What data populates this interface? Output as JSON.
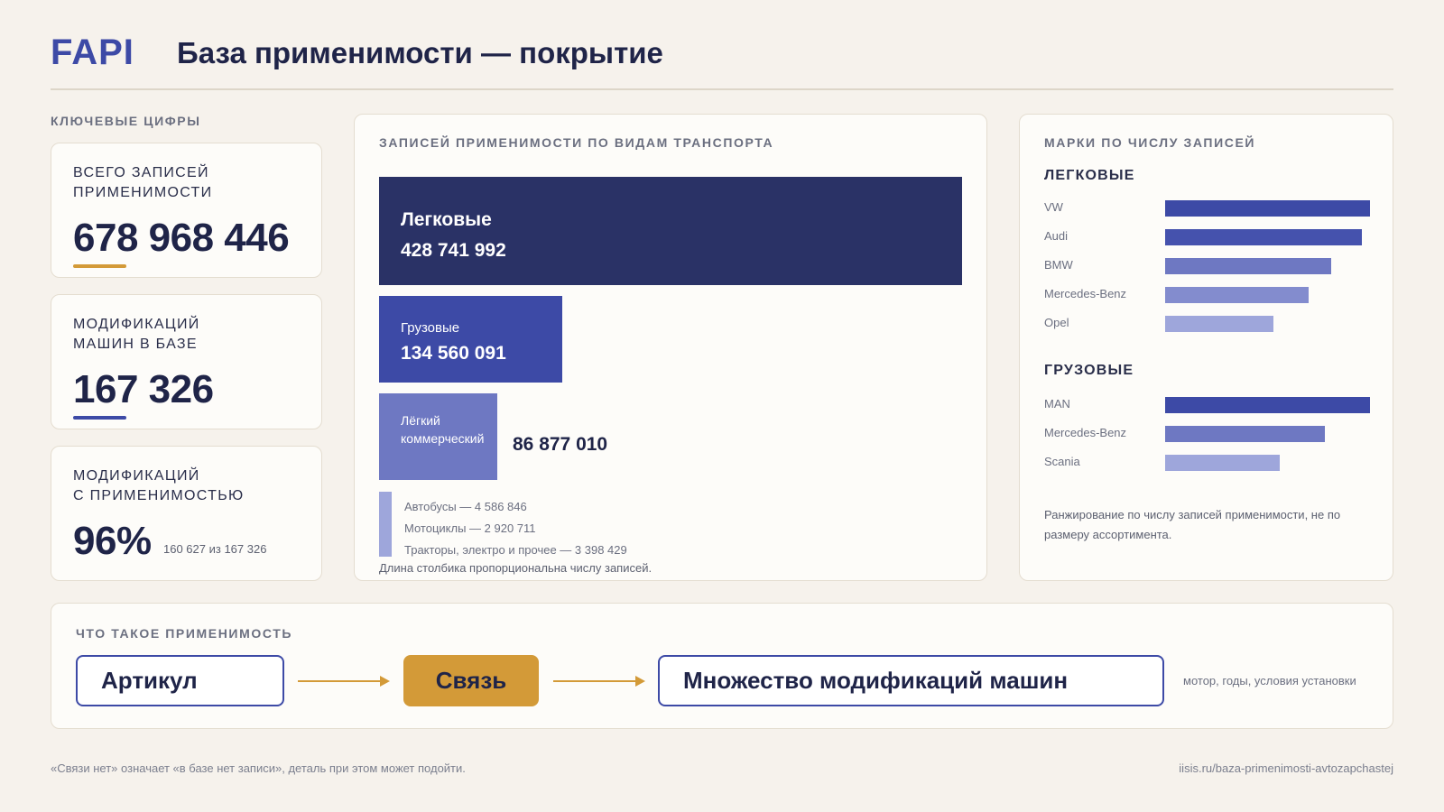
{
  "header": {
    "logo": "FAPI",
    "title": "База применимости — покрытие"
  },
  "kpi": {
    "section_label": "Ключевые цифры",
    "cards": [
      {
        "title_line1": "Всего записей",
        "title_line2": "применимости",
        "value": "678 968 446",
        "accent": "#d39a38"
      },
      {
        "title_line1": "Модификаций",
        "title_line2": "машин в базе",
        "value": "167 326",
        "accent": "#3d4aa6"
      },
      {
        "title_line1": "Модификаций",
        "title_line2": "с применимостью",
        "value": "96%",
        "sub": "160 627 из 167 326"
      }
    ]
  },
  "transport": {
    "section_label": "Записей применимости по видам транспорта",
    "items": [
      {
        "label": "Легковые",
        "value": "428 741 992",
        "color": "#2a3266"
      },
      {
        "label": "Грузовые",
        "value": "134 560 091",
        "color": "#3d4aa6"
      },
      {
        "label_line1": "Лёгкий",
        "label_line2": "коммерческий",
        "value": "86 877 010",
        "color": "#6e78c2"
      }
    ],
    "minor": [
      "Автобусы — 4 586 846",
      "Мотоциклы — 2 920 711",
      "Тракторы, электро и прочее — 3 398 429"
    ],
    "minor_color": "#9ea6db",
    "footnote": "Длина столбика пропорциональна числу записей."
  },
  "brands": {
    "section_label": "Марки по числу записей",
    "groups": [
      {
        "title": "Легковые",
        "rows": [
          {
            "label": "VW",
            "share": 1.0,
            "color": "#3d4aa6"
          },
          {
            "label": "Audi",
            "share": 0.96,
            "color": "#4552ad"
          },
          {
            "label": "BMW",
            "share": 0.81,
            "color": "#6e78c2"
          },
          {
            "label": "Mercedes-Benz",
            "share": 0.7,
            "color": "#838cce"
          },
          {
            "label": "Opel",
            "share": 0.53,
            "color": "#9ea6db"
          }
        ]
      },
      {
        "title": "Грузовые",
        "rows": [
          {
            "label": "MAN",
            "share": 1.0,
            "color": "#3d4aa6"
          },
          {
            "label": "Mercedes-Benz",
            "share": 0.78,
            "color": "#6e78c2"
          },
          {
            "label": "Scania",
            "share": 0.56,
            "color": "#9ea6db"
          }
        ]
      }
    ],
    "note": "Ранжирование по числу записей применимости, не по размеру ассортимента."
  },
  "concept": {
    "section_label": "Что такое применимость",
    "steps": [
      "Артикул",
      "Связь",
      "Множество модификаций машин"
    ],
    "note": "мотор, годы, условия установки",
    "accent": "#d39a38"
  },
  "footer": {
    "left": "«Связи нет» означает «в базе нет записи», деталь при этом может подойти.",
    "right": "iisis.ru/baza-primenimosti-avtozapchastej"
  }
}
